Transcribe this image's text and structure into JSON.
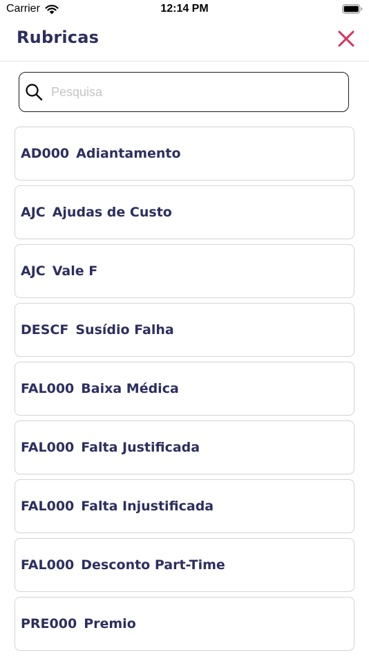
{
  "status_bar": {
    "carrier": "Carrier",
    "time": "12:14 PM",
    "wifi_icon": "wifi-icon",
    "battery_icon": "battery-icon"
  },
  "header": {
    "title": "Rubricas",
    "close_icon": "close-icon",
    "close_color": "#d6345a"
  },
  "search": {
    "placeholder": "Pesquisa",
    "value": "",
    "icon": "search-icon"
  },
  "colors": {
    "title_text": "#2d2e5f",
    "item_border": "#d3d3db",
    "placeholder": "#c4c4c8"
  },
  "items": [
    {
      "code": "AD000",
      "name": "Adiantamento"
    },
    {
      "code": "AJC",
      "name": "Ajudas de Custo"
    },
    {
      "code": "AJC",
      "name": "Vale F"
    },
    {
      "code": "DESCF",
      "name": "Susídio Falha"
    },
    {
      "code": "FAL000",
      "name": "Baixa Médica"
    },
    {
      "code": "FAL000",
      "name": "Falta Justificada"
    },
    {
      "code": "FAL000",
      "name": "Falta Injustificada"
    },
    {
      "code": "FAL000",
      "name": "Desconto Part-Time"
    },
    {
      "code": "PRE000",
      "name": "Premio"
    }
  ]
}
